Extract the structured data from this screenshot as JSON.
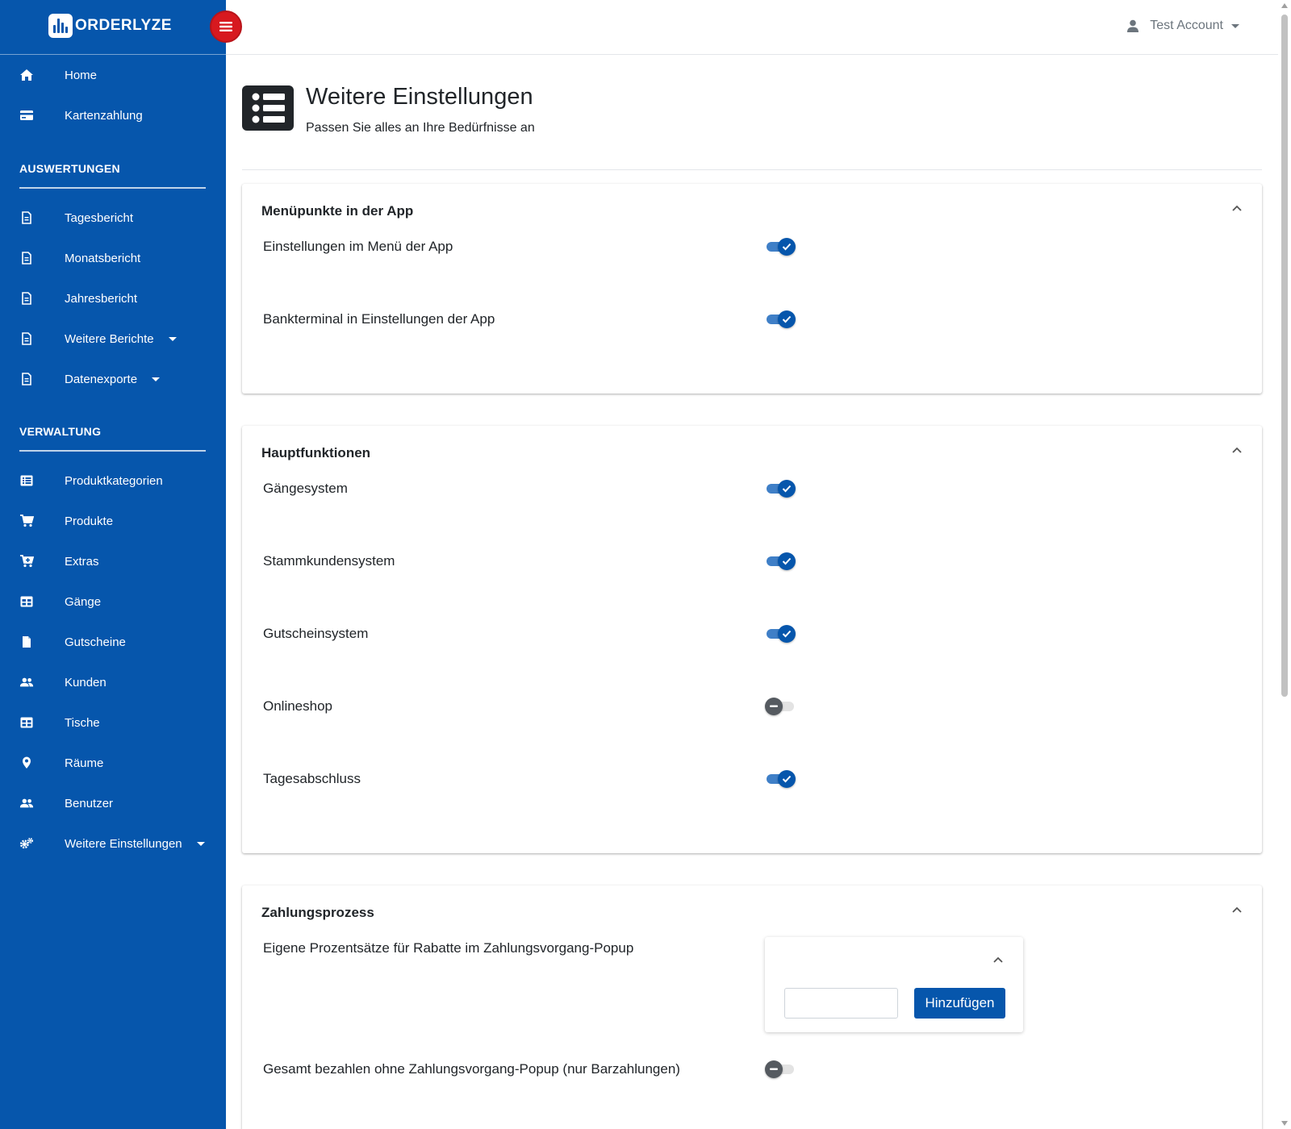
{
  "brand": {
    "name": "ORDERLYZE"
  },
  "topbar": {
    "account_name": "Test Account"
  },
  "sidebar": {
    "top_items": [
      {
        "label": "Home",
        "icon": "home-icon"
      },
      {
        "label": "Kartenzahlung",
        "icon": "credit-card-icon"
      }
    ],
    "sections": [
      {
        "title": "AUSWERTUNGEN",
        "items": [
          {
            "label": "Tagesbericht",
            "icon": "file-icon"
          },
          {
            "label": "Monatsbericht",
            "icon": "file-icon"
          },
          {
            "label": "Jahresbericht",
            "icon": "file-icon"
          },
          {
            "label": "Weitere Berichte",
            "icon": "file-icon",
            "dropdown": true
          },
          {
            "label": "Datenexporte",
            "icon": "file-icon",
            "dropdown": true
          }
        ]
      },
      {
        "title": "VERWALTUNG",
        "items": [
          {
            "label": "Produktkategorien",
            "icon": "list-icon"
          },
          {
            "label": "Produkte",
            "icon": "cart-icon"
          },
          {
            "label": "Extras",
            "icon": "cart-plus-icon"
          },
          {
            "label": "Gänge",
            "icon": "table-icon"
          },
          {
            "label": "Gutscheine",
            "icon": "document-icon"
          },
          {
            "label": "Kunden",
            "icon": "users-icon"
          },
          {
            "label": "Tische",
            "icon": "table-icon"
          },
          {
            "label": "Räume",
            "icon": "map-pin-icon"
          },
          {
            "label": "Benutzer",
            "icon": "users-icon"
          },
          {
            "label": "Weitere Einstellungen",
            "icon": "gears-icon",
            "dropdown": true
          }
        ]
      }
    ]
  },
  "page": {
    "title": "Weitere Einstellungen",
    "subtitle": "Passen Sie alles an Ihre Bedürfnisse an"
  },
  "cards": [
    {
      "title": "Menüpunkte in der App",
      "settings": [
        {
          "label": "Einstellungen im Menü der App",
          "enabled": true
        },
        {
          "label": "Bankterminal in Einstellungen der App",
          "enabled": true
        }
      ]
    },
    {
      "title": "Hauptfunktionen",
      "settings": [
        {
          "label": "Gängesystem",
          "enabled": true
        },
        {
          "label": "Stammkundensystem",
          "enabled": true
        },
        {
          "label": "Gutscheinsystem",
          "enabled": true
        },
        {
          "label": "Onlineshop",
          "enabled": false
        },
        {
          "label": "Tagesabschluss",
          "enabled": true
        }
      ]
    },
    {
      "title": "Zahlungsprozess",
      "settings": [
        {
          "label": "Eigene Prozentsätze für Rabatte im Zahlungsvorgang-Popup",
          "type": "percent-list"
        },
        {
          "label": "Gesamt bezahlen ohne Zahlungsvorgang-Popup (nur Barzahlungen)",
          "enabled": false
        }
      ],
      "percent_input": {
        "value": "",
        "add_label": "Hinzufügen"
      }
    }
  ],
  "colors": {
    "primary": "#0656ac",
    "hamburger": "#d7191f",
    "toggle_on": "#0656ac",
    "toggle_off": "#555a60"
  }
}
